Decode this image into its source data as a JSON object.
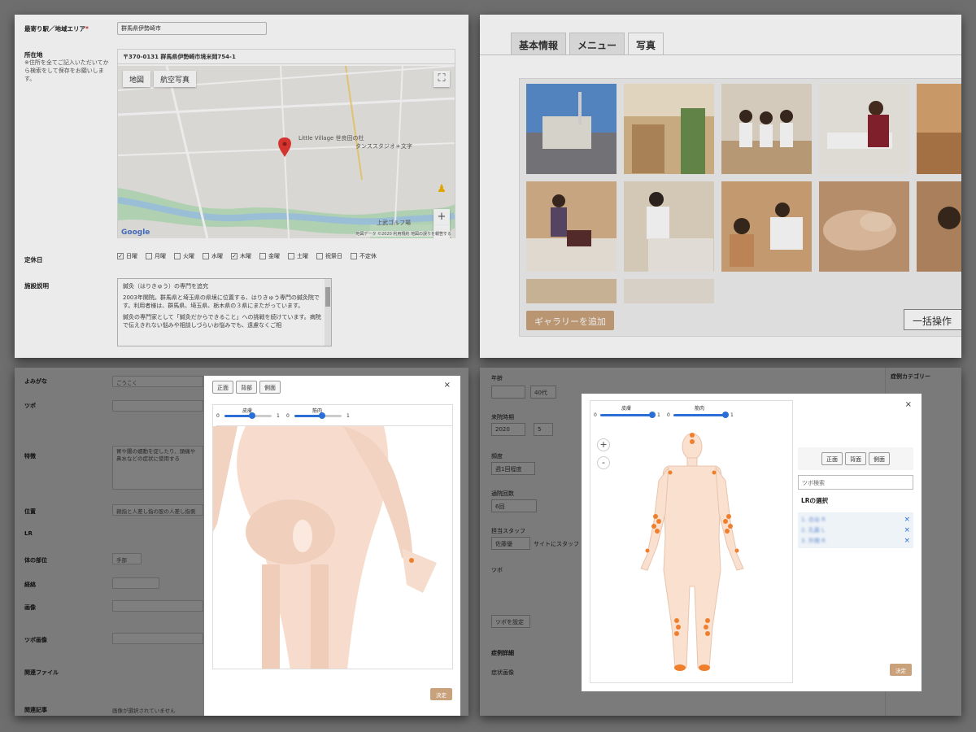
{
  "panel1": {
    "station_label": "最寄り駅／地域エリア",
    "required_mark": "*",
    "station_value": "群馬県伊勢崎市",
    "location_label": "所在地",
    "location_note": "※住所を全てご記入いただいてから検索をして保存をお願いします。",
    "address": "〒370-0131 群馬県伊勢崎市境米岡754-1",
    "map_tab_map": "地図",
    "map_tab_satellite": "航空写真",
    "map_place": "Little Village 世良田の杜",
    "map_place2": "タンススタジオ＊文字",
    "map_golf": "上武ゴルフ場",
    "google": "Google",
    "map_footer": "地図データ ©2020  利用規約  地図の誤りを報告する",
    "holiday_label": "定休日",
    "days": [
      {
        "label": "日曜",
        "checked": "✓"
      },
      {
        "label": "月曜",
        "checked": ""
      },
      {
        "label": "火曜",
        "checked": ""
      },
      {
        "label": "水曜",
        "checked": ""
      },
      {
        "label": "木曜",
        "checked": "✓"
      },
      {
        "label": "金曜",
        "checked": ""
      },
      {
        "label": "土曜",
        "checked": ""
      },
      {
        "label": "祝祭日",
        "checked": ""
      },
      {
        "label": "不定休",
        "checked": ""
      }
    ],
    "facility_label": "施設説明",
    "facility_text": [
      "鍼灸（はりきゅう）の専門を追究",
      "2003年開院。群馬県と埼玉県の県境に位置する、はりきゅう専門の鍼灸院です。利用者様は、群馬県、埼玉県、栃木県の３県にまたがっています。",
      "鍼灸の専門家として「鍼灸だからできること」への挑戦を続けています。病院で伝えきれない悩みや相談しづらいお悩みでも、遠慮なくご相"
    ]
  },
  "panel2": {
    "tabs": [
      "基本情報",
      "メニュー",
      "写真"
    ],
    "add_gallery": "ギャラリーを追加",
    "bulk": "一括操作"
  },
  "panel3": {
    "labels": [
      "よみがな",
      "ツボ",
      "特徴",
      "位置",
      "LR",
      "体の部位",
      "経絡",
      "画像",
      "ツボ画像",
      "関連ファイル",
      "関連記事"
    ],
    "yomi_value": "ごうこく",
    "part_value": "手部",
    "view_buttons": [
      "正面",
      "背部",
      "側面"
    ],
    "close": "×",
    "slider_skin": "皮膚",
    "slider_muscle": "筋肉",
    "slider_min": "0",
    "slider_max": "1",
    "zoom_in": "+",
    "zoom_out": "-",
    "ok": "決定",
    "feature_text": "胃や腸の蠕動を促したり、頭痛や鼻水などの症状に使用する",
    "position_text": "親指と人差し指の股の人差し指側",
    "related_none": "画像が選択されていません"
  },
  "panel4": {
    "labels": [
      "年齢",
      "来院時期",
      "頻度",
      "通院回数",
      "担当スタッフ",
      "ツボ",
      "症例詳細",
      "症状画像"
    ],
    "age_value": "40代",
    "year_value": "2020",
    "month_value": "5",
    "freq_value": "週1回程度",
    "count_value": "6回",
    "staff_value": "佐藤優",
    "site_label": "サイトにスタッフ",
    "tsubo_set": "ツボを設定",
    "side_title": "症例カテゴリー",
    "view_buttons": [
      "正面",
      "背面",
      "側面"
    ],
    "close": "×",
    "slider_skin": "皮膚",
    "slider_muscle": "筋肉",
    "slider_min": "0",
    "slider_max": "1",
    "zoom_in": "+",
    "zoom_out": "-",
    "search_placeholder": "ツボ検索",
    "lr_title": "LRの選択",
    "lr_items": [
      "1. 合谷 R",
      "2. 孔最 L",
      "3. 外関 R"
    ],
    "remove": "×",
    "ok": "決定"
  }
}
